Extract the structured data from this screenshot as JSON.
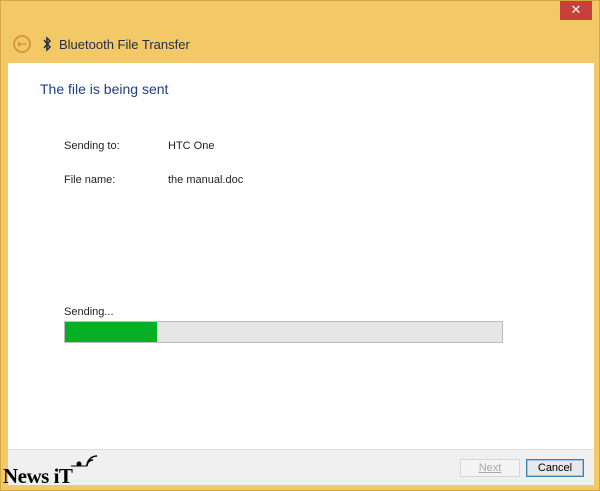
{
  "window": {
    "title": "Bluetooth File Transfer",
    "close_glyph": "✕",
    "back_glyph": "←"
  },
  "content": {
    "heading": "The file is being sent",
    "sending_to_label": "Sending to:",
    "sending_to_value": "HTC One",
    "file_name_label": "File name:",
    "file_name_value": "the manual.doc",
    "status_label": "Sending...",
    "progress_fraction": 0.21
  },
  "footer": {
    "next_label": "Next",
    "cancel_label": "Cancel"
  },
  "watermark": {
    "text": "News iT"
  },
  "colors": {
    "accent_frame": "#f3c866",
    "heading": "#1e3f86",
    "progress_fill": "#06b025",
    "close_button": "#c7403a"
  },
  "icons": [
    "bluetooth-icon",
    "back-arrow-icon",
    "close-icon",
    "watermark-logo-icon"
  ]
}
